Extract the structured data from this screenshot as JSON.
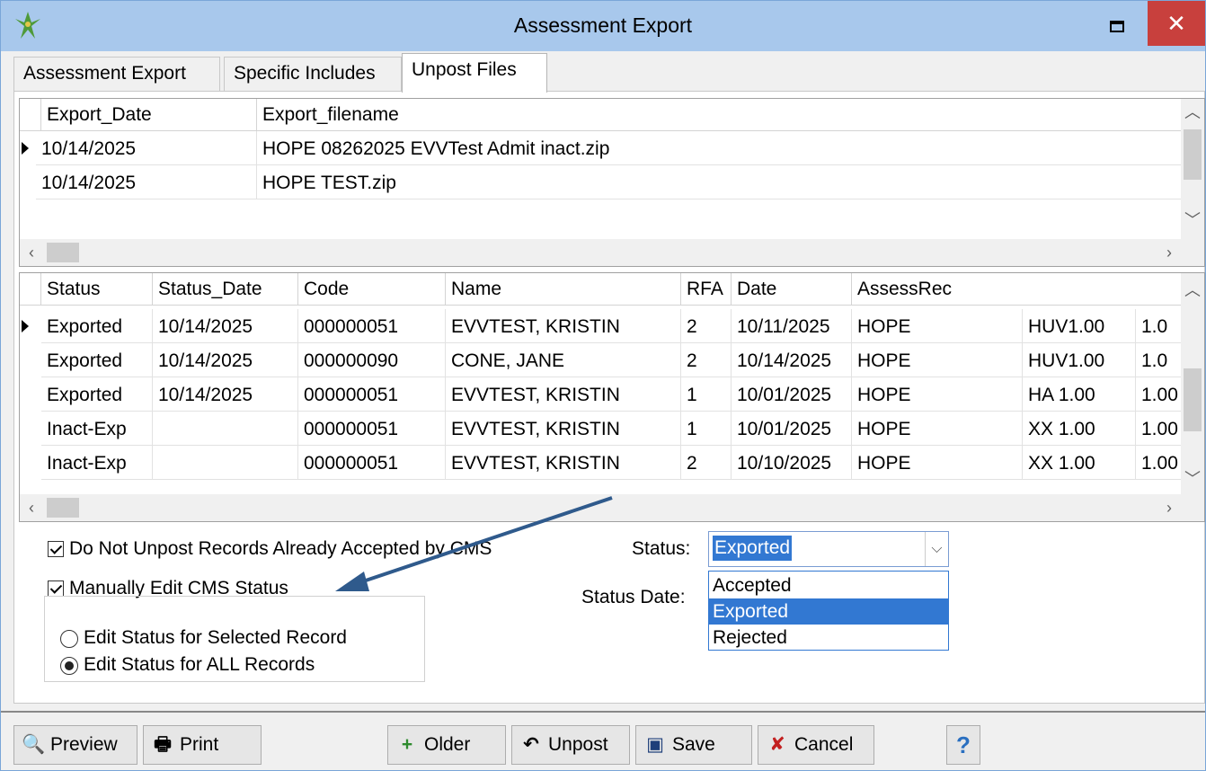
{
  "window": {
    "title": "Assessment Export",
    "close_glyph": "✕"
  },
  "tabs": [
    {
      "label": "Assessment Export"
    },
    {
      "label": "Specific Includes"
    },
    {
      "label": "Unpost Files"
    }
  ],
  "files_grid": {
    "columns": [
      "Export_Date",
      "Export_filename"
    ],
    "rows": [
      {
        "date": "10/14/2025",
        "filename": "HOPE 08262025 EVVTest Admit inact.zip"
      },
      {
        "date": "10/14/2025",
        "filename": "HOPE TEST.zip"
      }
    ]
  },
  "records_grid": {
    "columns": [
      "Status",
      "Status_Date",
      "Code",
      "Name",
      "RFA",
      "Date",
      "AssessRec"
    ],
    "rows": [
      {
        "status": "Exported",
        "status_date": "10/14/2025",
        "code": "000000051",
        "name": "EVVTEST, KRISTIN",
        "rfa": "2",
        "date": "10/11/2025",
        "assessrec": "HOPE",
        "c8": "HUV1.00",
        "c9": "1.0"
      },
      {
        "status": "Exported",
        "status_date": "10/14/2025",
        "code": "000000090",
        "name": "CONE, JANE",
        "rfa": "2",
        "date": "10/14/2025",
        "assessrec": "HOPE",
        "c8": "HUV1.00",
        "c9": "1.0"
      },
      {
        "status": "Exported",
        "status_date": "10/14/2025",
        "code": "000000051",
        "name": "EVVTEST, KRISTIN",
        "rfa": "1",
        "date": "10/01/2025",
        "assessrec": "HOPE",
        "c8": "HA 1.00",
        "c9": "1.00"
      },
      {
        "status": "Inact-Exp",
        "status_date": "",
        "code": "000000051",
        "name": "EVVTEST, KRISTIN",
        "rfa": "1",
        "date": "10/01/2025",
        "assessrec": "HOPE",
        "c8": "XX 1.00",
        "c9": "1.00"
      },
      {
        "status": "Inact-Exp",
        "status_date": "",
        "code": "000000051",
        "name": "EVVTEST, KRISTIN",
        "rfa": "2",
        "date": "10/10/2025",
        "assessrec": "HOPE",
        "c8": "XX 1.00",
        "c9": "1.00"
      }
    ]
  },
  "options": {
    "do_not_unpost_label": "Do Not Unpost Records Already Accepted by CMS",
    "do_not_unpost_checked": true,
    "manual_edit_label": "Manually Edit CMS Status",
    "manual_edit_checked": true,
    "radio_selected_label": "Edit Status for Selected Record",
    "radio_all_label": "Edit Status for ALL Records",
    "radio_value": "all"
  },
  "status_field": {
    "label": "Status:",
    "value": "Exported",
    "options": [
      "Accepted",
      "Exported",
      "Rejected"
    ]
  },
  "status_date_label": "Status Date:",
  "toolbar": {
    "preview": "Preview",
    "print": "Print",
    "older": "Older",
    "unpost": "Unpost",
    "save": "Save",
    "cancel": "Cancel",
    "help": "?"
  },
  "colors": {
    "title_bar": "#a8c8ec",
    "close": "#c8403d",
    "selection": "#3278d2",
    "arrow": "#2f5a8c"
  }
}
